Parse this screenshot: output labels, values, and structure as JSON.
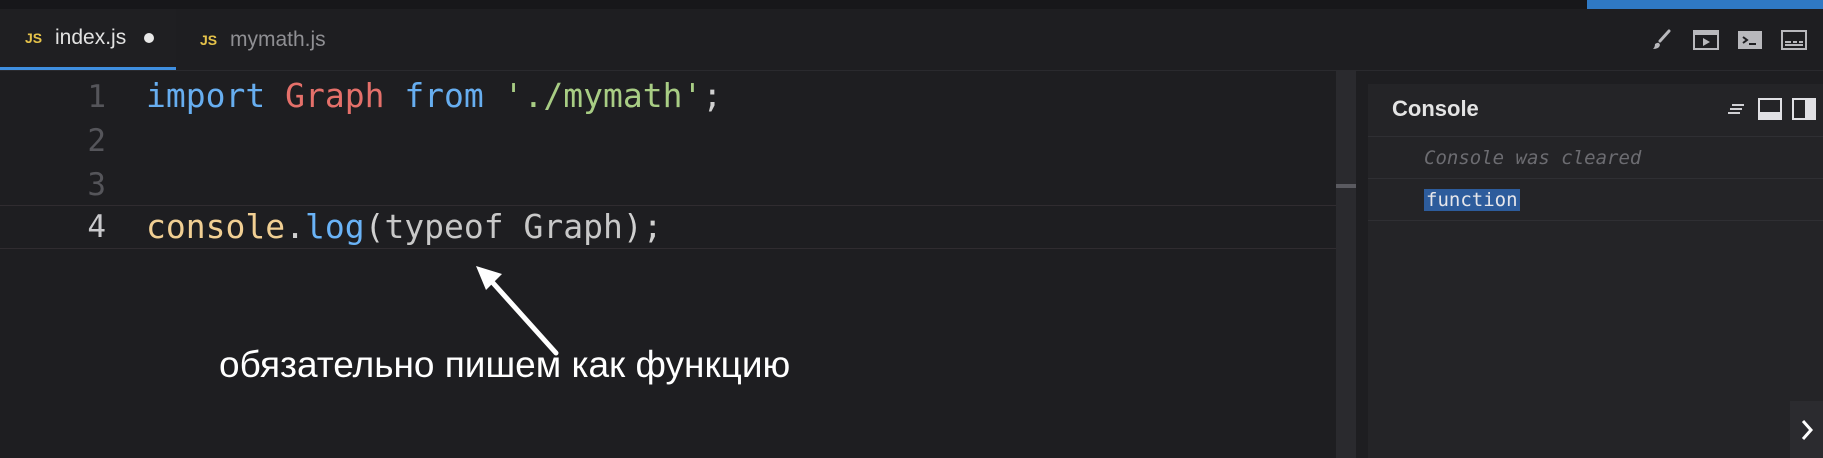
{
  "tabs": [
    {
      "icon_text": "JS",
      "label": "index.js",
      "dirty": true
    },
    {
      "icon_text": "JS",
      "label": "mymath.js",
      "dirty": false
    }
  ],
  "toolbar": {
    "icons": [
      "brush-icon",
      "preview-icon",
      "terminal-icon",
      "panel-icon"
    ]
  },
  "editor": {
    "line_numbers": [
      "1",
      "2",
      "3",
      "4"
    ],
    "line1": {
      "kw_import": "import",
      "ident": "Graph",
      "kw_from": "from",
      "string": "'./mymath'",
      "semi": ";"
    },
    "line4": {
      "obj": "console",
      "dot": ".",
      "method": "log",
      "open": "(",
      "kw_typeof": "typeof",
      "ident": "Graph",
      "close": ");"
    }
  },
  "caption": "обязательно пишем как функцию",
  "console": {
    "title": "Console",
    "rows": [
      "Console was cleared",
      "function"
    ]
  },
  "colors": {
    "accent": "#2f79c4",
    "keyword": "#67aef0",
    "string": "#a8cd84",
    "identifier": "#e5706a"
  }
}
